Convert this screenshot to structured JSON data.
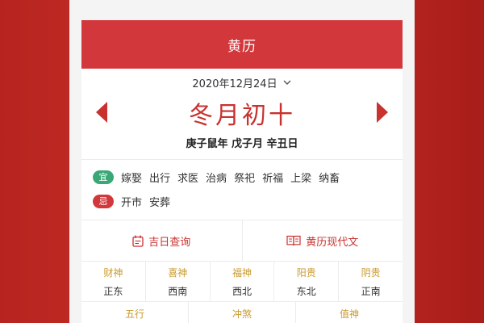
{
  "header": {
    "title": "黄历"
  },
  "date": {
    "label": "2020年12月24日"
  },
  "lunar": {
    "date": "冬月初十"
  },
  "ganzhi": {
    "text": "庚子鼠年 戊子月 辛丑日"
  },
  "yi": {
    "badge": "宜",
    "items": [
      "嫁娶",
      "出行",
      "求医",
      "治病",
      "祭祀",
      "祈福",
      "上梁",
      "纳畜"
    ]
  },
  "ji": {
    "badge": "忌",
    "items": [
      "开市",
      "安葬"
    ]
  },
  "actions": {
    "lucky_day": "吉日查询",
    "modern_text": "黄历现代文"
  },
  "gods": [
    {
      "name": "财神",
      "dir": "正东"
    },
    {
      "name": "喜神",
      "dir": "西南"
    },
    {
      "name": "福神",
      "dir": "西北"
    },
    {
      "name": "阳贵",
      "dir": "东北"
    },
    {
      "name": "阴贵",
      "dir": "正南"
    }
  ],
  "bottom": [
    "五行",
    "冲煞",
    "值神"
  ],
  "colors": {
    "accent": "#d2373b",
    "gold": "#c99a2e",
    "green": "#3aa876"
  }
}
